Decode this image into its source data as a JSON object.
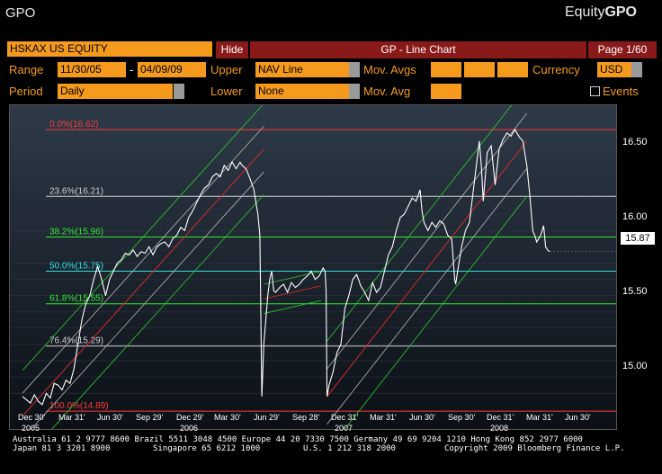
{
  "topbar": {
    "title": "GPO",
    "brand_prefix": "Equity",
    "brand_suffix": "GPO"
  },
  "header": {
    "ticker": "HSKAX US EQUITY",
    "hide_label": "Hide",
    "chart_title": "GP - Line Chart",
    "page": "Page 1/60"
  },
  "controls": {
    "range_label": "Range",
    "range_start": "11/30/05",
    "range_sep": "-",
    "range_end": "04/09/09",
    "upper_label": "Upper",
    "upper_value": "NAV Line",
    "movavgs_label": "Mov. Avgs",
    "currency_label": "Currency",
    "currency_value": "USD",
    "period_label": "Period",
    "period_value": "Daily",
    "lower_label": "Lower",
    "lower_value": "None",
    "movavg_label": "Mov. Avg",
    "events_label": "Events"
  },
  "chart_data": {
    "type": "line",
    "y_ticks": [
      "16.50",
      "16.00",
      "15.50",
      "15.00"
    ],
    "ylim": [
      14.78,
      16.77
    ],
    "last_value": "15.87",
    "x_ticks": [
      "Dec 30'",
      "Mar 31'",
      "Jun 30'",
      "Sep 29'",
      "Dec 29'",
      "Mar 30'",
      "Jun 29'",
      "Sep 28'",
      "Dec 31'",
      "Mar 31'",
      "Jun 30'",
      "Sep 30'",
      "Dec 31'",
      "Mar 31'",
      "Jun 30'"
    ],
    "years": [
      "2005",
      "2006",
      "2007",
      "2008"
    ],
    "fib_levels": [
      {
        "label": "0.0%(16.62)",
        "value": 16.62,
        "color": "#ff3b3b"
      },
      {
        "label": "23.6%(16.21)",
        "value": 16.21,
        "color": "#cfcfcf"
      },
      {
        "label": "38.2%(15.96)",
        "value": 15.96,
        "color": "#36e636"
      },
      {
        "label": "50.0%(15.75)",
        "value": 15.75,
        "color": "#34e0e0"
      },
      {
        "label": "61.8%(15.55)",
        "value": 15.55,
        "color": "#36e636"
      },
      {
        "label": "76.4%(15.29)",
        "value": 15.29,
        "color": "#cfcfcf"
      },
      {
        "label": "100.0%(14.89)",
        "value": 14.89,
        "color": "#ff3b3b"
      }
    ],
    "series": [
      {
        "values": [
          [
            0,
            14.98
          ],
          [
            4,
            14.96
          ],
          [
            8,
            14.94
          ],
          [
            12,
            14.99
          ],
          [
            16,
            14.95
          ],
          [
            20,
            14.93
          ],
          [
            24,
            15.0
          ],
          [
            28,
            14.97
          ],
          [
            32,
            15.06
          ],
          [
            36,
            15.05
          ],
          [
            40,
            15.02
          ],
          [
            44,
            15.08
          ],
          [
            48,
            15.06
          ],
          [
            52,
            15.15
          ],
          [
            56,
            15.3
          ],
          [
            60,
            15.45
          ],
          [
            64,
            15.55
          ],
          [
            68,
            15.6
          ],
          [
            72,
            15.7
          ],
          [
            76,
            15.78
          ],
          [
            80,
            15.7
          ],
          [
            84,
            15.6
          ],
          [
            88,
            15.7
          ],
          [
            92,
            15.75
          ],
          [
            96,
            15.8
          ],
          [
            100,
            15.82
          ],
          [
            104,
            15.86
          ],
          [
            108,
            15.85
          ],
          [
            112,
            15.88
          ],
          [
            116,
            15.84
          ],
          [
            120,
            15.87
          ],
          [
            124,
            15.86
          ],
          [
            128,
            15.9
          ],
          [
            132,
            15.85
          ],
          [
            136,
            15.9
          ],
          [
            140,
            15.92
          ],
          [
            144,
            15.93
          ],
          [
            148,
            15.9
          ],
          [
            152,
            15.95
          ],
          [
            156,
            15.97
          ],
          [
            160,
            16.02
          ],
          [
            164,
            16.0
          ],
          [
            168,
            16.08
          ],
          [
            172,
            16.12
          ],
          [
            176,
            16.17
          ],
          [
            180,
            16.22
          ],
          [
            184,
            16.26
          ],
          [
            188,
            16.28
          ],
          [
            192,
            16.33
          ],
          [
            196,
            16.35
          ],
          [
            200,
            16.33
          ],
          [
            204,
            16.4
          ],
          [
            208,
            16.37
          ],
          [
            212,
            16.42
          ],
          [
            216,
            16.38
          ],
          [
            220,
            16.42
          ],
          [
            222,
            16.4
          ],
          [
            226,
            16.38
          ],
          [
            230,
            16.32
          ],
          [
            234,
            16.25
          ],
          [
            238,
            16.1
          ],
          [
            240,
            15.97
          ],
          [
            242,
            14.98
          ],
          [
            244,
            15.3
          ],
          [
            246,
            15.45
          ],
          [
            248,
            15.6
          ],
          [
            250,
            15.7
          ],
          [
            252,
            15.75
          ],
          [
            254,
            15.63
          ],
          [
            256,
            15.62
          ],
          [
            260,
            15.65
          ],
          [
            264,
            15.67
          ],
          [
            268,
            15.62
          ],
          [
            272,
            15.68
          ],
          [
            276,
            15.65
          ],
          [
            280,
            15.67
          ],
          [
            284,
            15.7
          ],
          [
            288,
            15.72
          ],
          [
            292,
            15.75
          ],
          [
            296,
            15.7
          ],
          [
            300,
            15.72
          ],
          [
            304,
            15.77
          ],
          [
            306,
            15.75
          ],
          [
            307,
            15.64
          ],
          [
            308,
            14.98
          ],
          [
            310,
            15.05
          ],
          [
            314,
            15.13
          ],
          [
            318,
            15.25
          ],
          [
            322,
            15.3
          ],
          [
            326,
            15.52
          ],
          [
            330,
            15.6
          ],
          [
            334,
            15.7
          ],
          [
            338,
            15.73
          ],
          [
            342,
            15.66
          ],
          [
            346,
            15.62
          ],
          [
            350,
            15.57
          ],
          [
            354,
            15.68
          ],
          [
            358,
            15.62
          ],
          [
            362,
            15.65
          ],
          [
            366,
            15.75
          ],
          [
            370,
            15.85
          ],
          [
            374,
            15.9
          ],
          [
            378,
            16.0
          ],
          [
            382,
            16.08
          ],
          [
            386,
            16.1
          ],
          [
            390,
            16.15
          ],
          [
            394,
            16.2
          ],
          [
            398,
            16.18
          ],
          [
            402,
            16.25
          ],
          [
            404,
            16.12
          ],
          [
            406,
            16.05
          ],
          [
            410,
            16.0
          ],
          [
            414,
            16.05
          ],
          [
            418,
            16.02
          ],
          [
            422,
            16.06
          ],
          [
            426,
            16.04
          ],
          [
            430,
            15.97
          ],
          [
            434,
            15.95
          ],
          [
            437,
            15.7
          ],
          [
            438,
            15.67
          ],
          [
            440,
            15.75
          ],
          [
            444,
            15.9
          ],
          [
            448,
            16.0
          ],
          [
            452,
            16.05
          ],
          [
            456,
            16.25
          ],
          [
            460,
            16.45
          ],
          [
            462,
            16.55
          ],
          [
            464,
            16.4
          ],
          [
            466,
            16.18
          ],
          [
            470,
            16.48
          ],
          [
            474,
            16.52
          ],
          [
            478,
            16.28
          ],
          [
            482,
            16.5
          ],
          [
            486,
            16.56
          ],
          [
            490,
            16.6
          ],
          [
            494,
            16.58
          ],
          [
            498,
            16.62
          ],
          [
            500,
            16.6
          ],
          [
            503,
            16.57
          ],
          [
            506,
            16.55
          ],
          [
            510,
            16.4
          ],
          [
            513,
            16.22
          ],
          [
            516,
            16.0
          ],
          [
            518,
            15.97
          ],
          [
            520,
            15.93
          ],
          [
            524,
            15.97
          ],
          [
            527,
            16.03
          ],
          [
            529,
            15.9
          ],
          [
            531,
            15.88
          ],
          [
            533,
            15.87
          ]
        ]
      }
    ]
  },
  "footer": {
    "line1": "Australia 61 2 9777 8600 Brazil 5511 3048 4500 Europe 44 20 7330 7500 Germany 49 69 9204 1210 Hong Kong 852 2977 6000",
    "line2_left": "Japan 81 3 3201 8900",
    "line2_mid1": "Singapore 65 6212 1000",
    "line2_mid2": "U.S. 1 212 318 2000",
    "line2_right": "Copyright 2009 Bloomberg Finance L.P."
  }
}
